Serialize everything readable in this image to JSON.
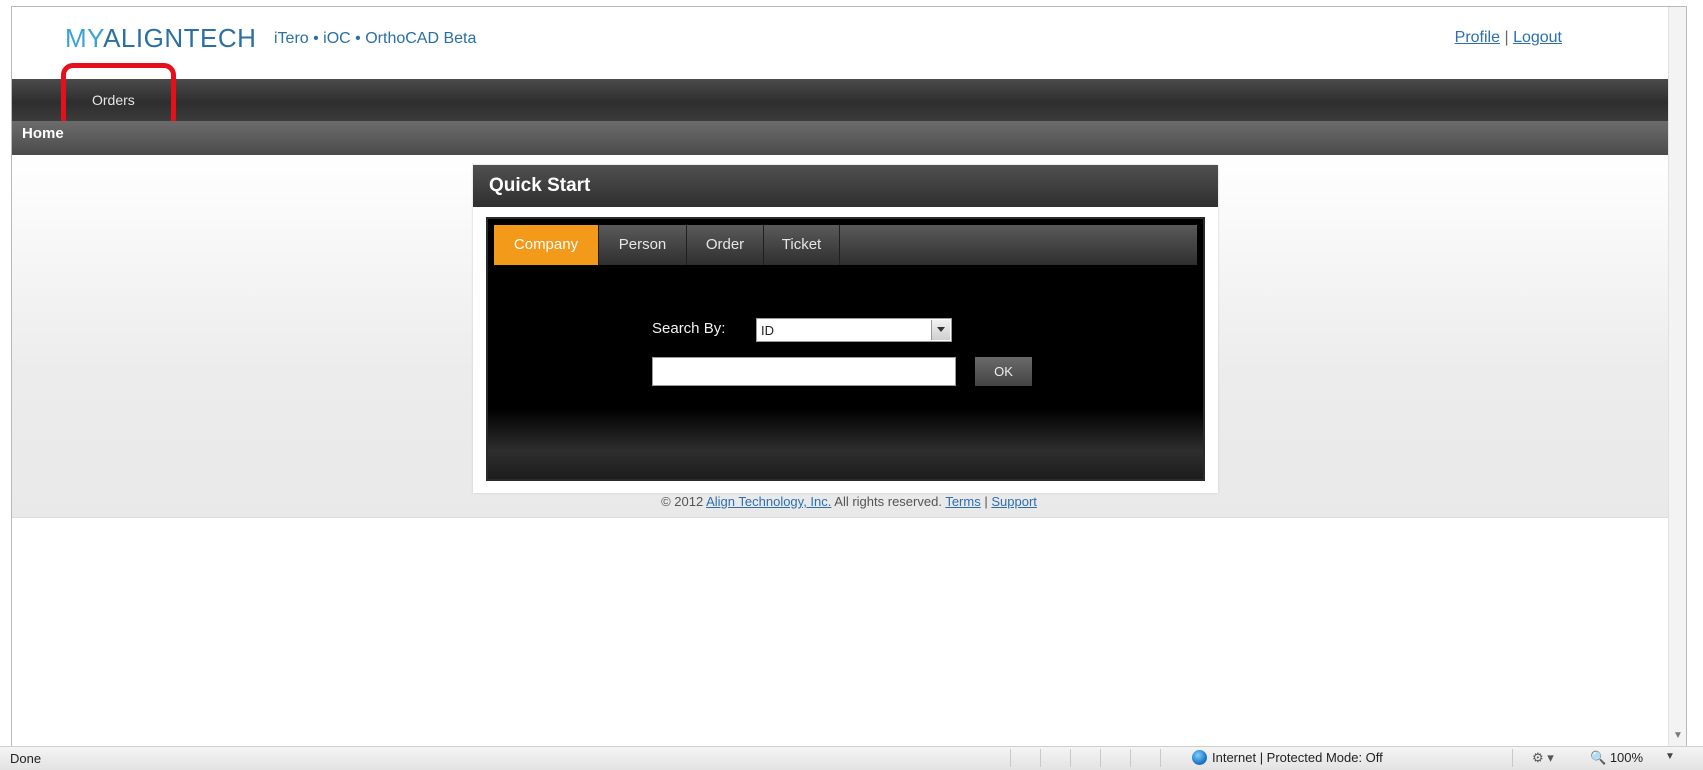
{
  "header": {
    "logo_my": "MY",
    "logo_rest": "ALIGNTECH",
    "products": "iTero • iOC • OrthoCAD Beta",
    "profile_link": "Profile",
    "link_separator": "|",
    "logout_link": "Logout"
  },
  "nav": {
    "orders_label": "Orders"
  },
  "breadcrumb": {
    "home": "Home"
  },
  "quick_start": {
    "title": "Quick Start",
    "tabs": [
      {
        "label": "Company",
        "active": true
      },
      {
        "label": "Person",
        "active": false
      },
      {
        "label": "Order",
        "active": false
      },
      {
        "label": "Ticket",
        "active": false
      }
    ],
    "search_by_label": "Search By:",
    "search_by_value": "ID",
    "search_input_value": "",
    "ok_label": "OK"
  },
  "footer": {
    "copyright": "© 2012",
    "company_link": "Align Technology, Inc.",
    "rights": "All rights reserved.",
    "terms_link": "Terms",
    "separator": "|",
    "support_link": "Support"
  },
  "statusbar": {
    "status": "Done",
    "zone": "Internet | Protected Mode: Off",
    "zoom": "100%"
  },
  "colors": {
    "accent_tab": "#f39a1b",
    "logo_blue": "#3aa3d6",
    "highlight_red": "#e5101c"
  }
}
